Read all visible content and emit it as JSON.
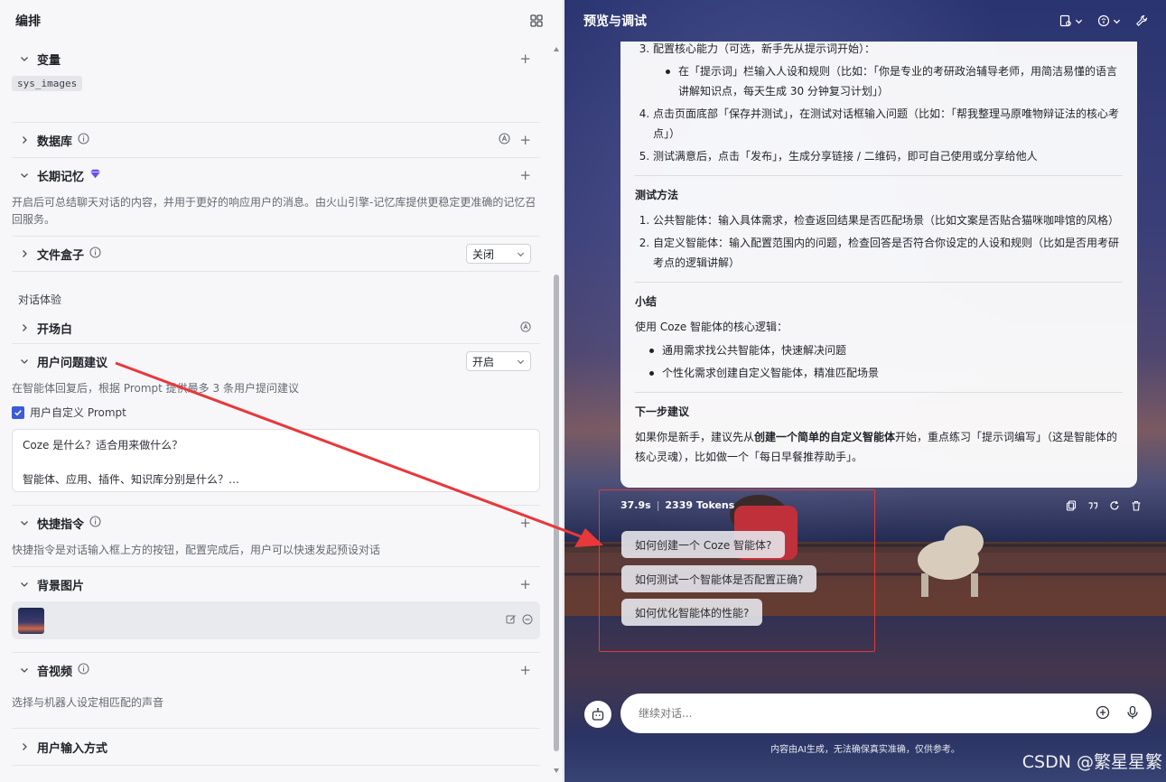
{
  "left": {
    "title": "编排",
    "variables": {
      "label": "变量",
      "chip": "sys_images"
    },
    "database": {
      "label": "数据库"
    },
    "longterm_memory": {
      "label": "长期记忆",
      "desc": "开启后可总结聊天对话的内容，并用于更好的响应用户的消息。由火山引擎-记忆库提供更稳定更准确的记忆召回服务。"
    },
    "file_box": {
      "label": "文件盒子",
      "select_value": "关闭"
    },
    "group_label": "对话体验",
    "opening": {
      "label": "开场白"
    },
    "suggestions": {
      "label": "用户问题建议",
      "select_value": "开启",
      "desc": "在智能体回复后，根据 Prompt 提供最多 3 条用户提问建议",
      "checkbox_label": "用户自定义 Prompt",
      "prompt_line1": "Coze 是什么？适合用来做什么？",
      "prompt_line2": "智能体、应用、插件、知识库分别是什么？…"
    },
    "shortcuts": {
      "label": "快捷指令",
      "desc": "快捷指令是对话输入框上方的按钮，配置完成后，用户可以快速发起预设对话"
    },
    "background": {
      "label": "背景图片"
    },
    "audio": {
      "label": "音视频",
      "desc": "选择与机器人设定相匹配的声音"
    },
    "input_mode": {
      "label": "用户输入方式"
    }
  },
  "right": {
    "title": "预览与调试",
    "chat": {
      "step3": "配置核心能力（可选，新手先从提示词开始）：",
      "step3_bullet": "在「提示词」栏输入人设和规则（比如：「你是专业的考研政治辅导老师，用简洁易懂的语言讲解知识点，每天生成 30 分钟复习计划」）",
      "step4": "点击页面底部「保存并测试」，在测试对话框输入问题（比如：「帮我整理马原唯物辩证法的核心考点」）",
      "step5": "测试满意后，点击「发布」，生成分享链接 / 二维码，即可自己使用或分享给他人",
      "test_heading": "测试方法",
      "test1": "公共智能体：输入具体需求，检查返回结果是否匹配场景（比如文案是否贴合猫咪咖啡馆的风格）",
      "test2": "自定义智能体：输入配置范围内的问题，检查回答是否符合你设定的人设和规则（比如是否用考研考点的逻辑讲解）",
      "summary_heading": "小结",
      "summary_intro": "使用 Coze 智能体的核心逻辑：",
      "summary1": "通用需求找公共智能体，快速解决问题",
      "summary2": "个性化需求创建自定义智能体，精准匹配场景",
      "next_heading": "下一步建议",
      "next_pre": "如果你是新手，建议先从",
      "next_bold": "创建一个简单的自定义智能体",
      "next_post": "开始，重点练习「提示词编写」（这是智能体的核心灵魂），比如做一个「每日早餐推荐助手」。"
    },
    "meta": {
      "time": "37.9s",
      "sep": "|",
      "tokens": "2339 Tokens"
    },
    "suggestions": [
      "如何创建一个 Coze 智能体?",
      "如何测试一个智能体是否配置正确?",
      "如何优化智能体的性能?"
    ],
    "input_placeholder": "继续对话...",
    "disclaimer": "内容由AI生成，无法确保真实准确，仅供参考。"
  },
  "watermark": "CSDN @繁星星繁",
  "colors": {
    "accent": "#3b5bdb",
    "highlight_red": "#e23a3a",
    "memory_badge": "#6a4cf5"
  }
}
